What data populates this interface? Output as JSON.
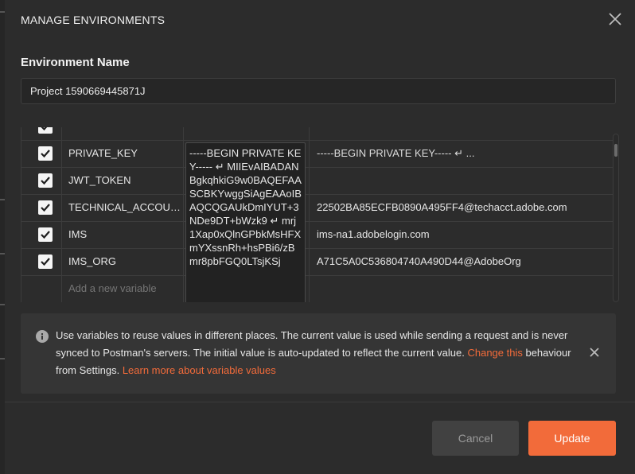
{
  "modal": {
    "title": "MANAGE ENVIRONMENTS",
    "env_name_label": "Environment Name",
    "env_name_value": "Project 1590669445871J"
  },
  "variables": [
    {
      "checked": true,
      "key": "",
      "initial": "",
      "current": ""
    },
    {
      "checked": true,
      "key": "PRIVATE_KEY",
      "initial": "-----BEGIN PRIVATE KEY----- ↵ MIIEvAIBADANBgkqhkiG9w0BAQEFAASCBKYwggSiAgEAAoIBAQCQGAUkDmIYUT+3NDe9DT+bWzk9 ↵ mrj1Xap0xQlnGPbkMsHFXmYXssnRh+hsPBi6/zBmr8pbFGQ0LTsjKSj",
      "current": "-----BEGIN PRIVATE KEY----- ↵ ..."
    },
    {
      "checked": true,
      "key": "JWT_TOKEN",
      "initial": "",
      "current": ""
    },
    {
      "checked": true,
      "key": "TECHNICAL_ACCOUNT_ID",
      "initial": "",
      "current": "22502BA85ECFB0890A495FF4@techacct.adobe.com"
    },
    {
      "checked": true,
      "key": "IMS",
      "initial": "",
      "current": "ims-na1.adobelogin.com"
    },
    {
      "checked": true,
      "key": "IMS_ORG",
      "initial": "",
      "current": "A71C5A0C536804740A490D44@AdobeOrg"
    }
  ],
  "new_variable_placeholder": "Add a new variable",
  "info": {
    "text_before": "Use variables to reuse values in different places. The current value is used while sending a request and is never synced to Postman's servers. The initial value is auto-updated to reflect the current value. ",
    "link_change": "Change this",
    "text_middle": " behaviour from Settings. ",
    "link_learn": "Learn more about variable values"
  },
  "buttons": {
    "cancel": "Cancel",
    "update": "Update"
  },
  "colors": {
    "accent": "#f26b3a",
    "modal_bg": "#2c2c2c"
  }
}
